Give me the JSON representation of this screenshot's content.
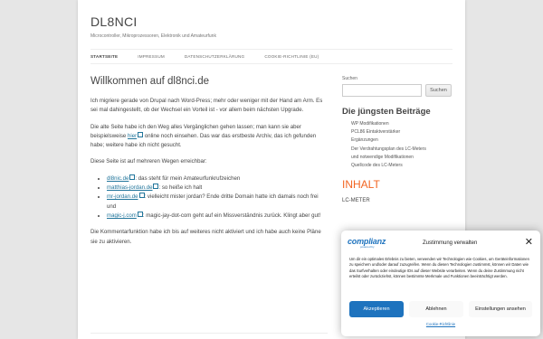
{
  "site": {
    "title": "DL8NCI",
    "description": "Microcontroller, Mikroprozessoren, Elektronik und Amateurfunk"
  },
  "nav": [
    "STARTSEITE",
    "IMPRESSUM",
    "DATENSCHUTZERKLÄRUNG",
    "COOKIE-RICHTLINIE (EU)"
  ],
  "post": {
    "title": "Willkommen auf dl8nci.de",
    "p1": "Ich migriere gerade von Drupal nach Word-Press; mehr oder weniger mit der Hand am Arm. Es sei mal dahingestellt, ob der Wechsel ein Vorteil ist - vor allem beim nächsten Upgrade.",
    "p2_before": "Die alte Seite habe ich den Weg alles Vergänglichen gehen lassen; man kann sie aber beispielsweise ",
    "p2_link": "hier",
    "p2_after": " online noch einsehen. Das war das erstbeste Archiv, das ich gefunden habe; weitere habe ich nicht gesucht.",
    "p3": "Diese Seite ist auf mehreren Wegen erreichbar:",
    "domains": [
      {
        "link": "dl8nic.de",
        "text": ": das steht für mein Amateurfunkrufzeichen"
      },
      {
        "link": "matthias-jordan.de",
        "text": ": so heiße ich halt"
      },
      {
        "link": "mr-jordan.de",
        "text": ": vielleicht mister jordan? Ende dritte Domain hatte ich damals noch frei und"
      },
      {
        "link": "magic-j.com",
        "text": ": magic-jay-dot-com geht auf ein Missverständnis zurück. Klingt aber gut!"
      }
    ],
    "p4": "Die Kommentarfunktion habe ich bis auf weiteres nicht aktiviert und ich habe auch keine Pläne sie zu aktivieren."
  },
  "sidebar": {
    "search_label": "Suchen",
    "search_button": "Suchen",
    "recent_title": "Die jüngsten Beiträge",
    "recent": [
      "WP Modifikationen",
      "PCL86 Eintaktverstärker",
      "Ergänzungen",
      "Der Verdrahtungsplan des LC-Meters",
      "und notwendige Modifikationen",
      "Quellcode des LC-Meters"
    ],
    "inhalt_title": "INHALT",
    "lc_meter": "LC-METER"
  },
  "consent": {
    "logo_main": "complianz",
    "logo_sub": "powered by",
    "title": "Zustimmung verwalten",
    "close": "✕",
    "text": "Um dir ein optimales Erlebnis zu bieten, verwenden wir Technologien wie Cookies, um Geräteinformationen zu speichern und/oder darauf zuzugreifen. Wenn du diesen Technologien zustimmst, können wir Daten wie das Surfverhalten oder eindeutige IDs auf dieser Website verarbeiten. Wenn du deine Zustimmung nicht erteilst oder zurückziehst, können bestimmte Merkmale und Funktionen beeinträchtigt werden.",
    "accept": "Akzeptieren",
    "deny": "Ablehnen",
    "settings": "Einstellungen ansehen",
    "link": "Cookie-Richtlinie"
  },
  "colors": {
    "link": "#21759b",
    "accent": "#f26522",
    "consent_primary": "#1e73be"
  }
}
